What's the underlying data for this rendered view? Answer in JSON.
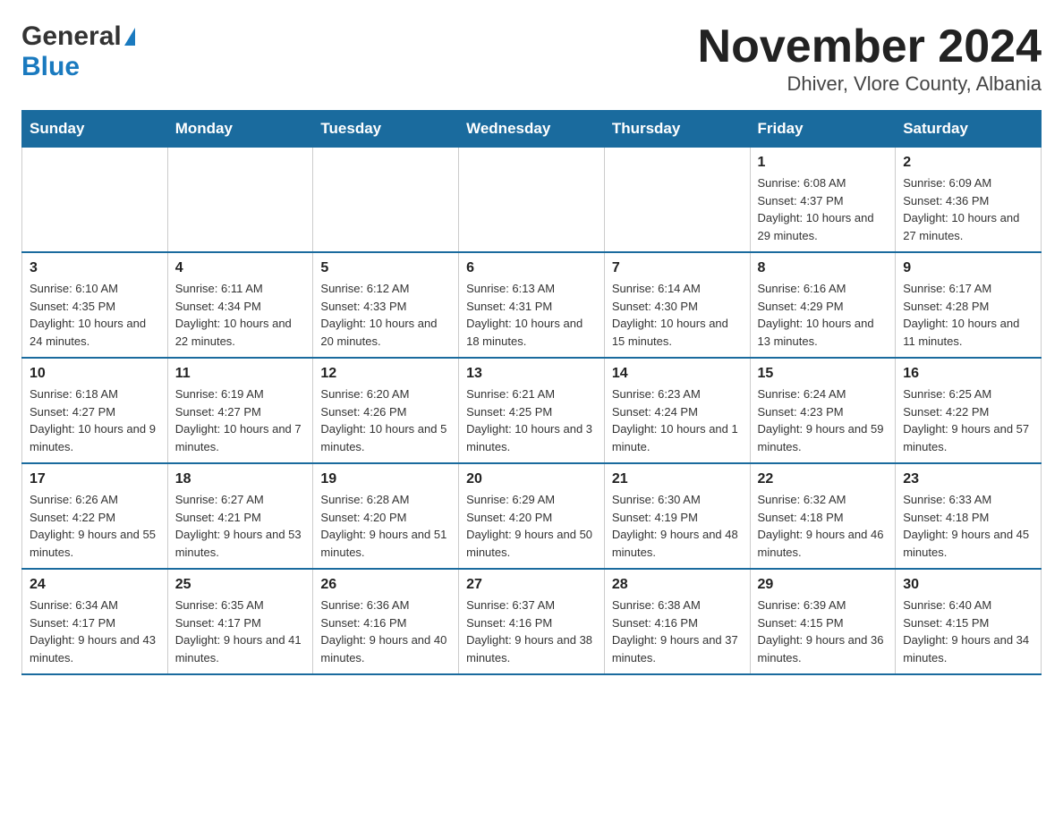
{
  "header": {
    "title": "November 2024",
    "subtitle": "Dhiver, Vlore County, Albania",
    "logo_general": "General",
    "logo_blue": "Blue"
  },
  "weekdays": [
    "Sunday",
    "Monday",
    "Tuesday",
    "Wednesday",
    "Thursday",
    "Friday",
    "Saturday"
  ],
  "weeks": [
    {
      "days": [
        {
          "number": "",
          "info": ""
        },
        {
          "number": "",
          "info": ""
        },
        {
          "number": "",
          "info": ""
        },
        {
          "number": "",
          "info": ""
        },
        {
          "number": "",
          "info": ""
        },
        {
          "number": "1",
          "info": "Sunrise: 6:08 AM\nSunset: 4:37 PM\nDaylight: 10 hours and 29 minutes."
        },
        {
          "number": "2",
          "info": "Sunrise: 6:09 AM\nSunset: 4:36 PM\nDaylight: 10 hours and 27 minutes."
        }
      ]
    },
    {
      "days": [
        {
          "number": "3",
          "info": "Sunrise: 6:10 AM\nSunset: 4:35 PM\nDaylight: 10 hours and 24 minutes."
        },
        {
          "number": "4",
          "info": "Sunrise: 6:11 AM\nSunset: 4:34 PM\nDaylight: 10 hours and 22 minutes."
        },
        {
          "number": "5",
          "info": "Sunrise: 6:12 AM\nSunset: 4:33 PM\nDaylight: 10 hours and 20 minutes."
        },
        {
          "number": "6",
          "info": "Sunrise: 6:13 AM\nSunset: 4:31 PM\nDaylight: 10 hours and 18 minutes."
        },
        {
          "number": "7",
          "info": "Sunrise: 6:14 AM\nSunset: 4:30 PM\nDaylight: 10 hours and 15 minutes."
        },
        {
          "number": "8",
          "info": "Sunrise: 6:16 AM\nSunset: 4:29 PM\nDaylight: 10 hours and 13 minutes."
        },
        {
          "number": "9",
          "info": "Sunrise: 6:17 AM\nSunset: 4:28 PM\nDaylight: 10 hours and 11 minutes."
        }
      ]
    },
    {
      "days": [
        {
          "number": "10",
          "info": "Sunrise: 6:18 AM\nSunset: 4:27 PM\nDaylight: 10 hours and 9 minutes."
        },
        {
          "number": "11",
          "info": "Sunrise: 6:19 AM\nSunset: 4:27 PM\nDaylight: 10 hours and 7 minutes."
        },
        {
          "number": "12",
          "info": "Sunrise: 6:20 AM\nSunset: 4:26 PM\nDaylight: 10 hours and 5 minutes."
        },
        {
          "number": "13",
          "info": "Sunrise: 6:21 AM\nSunset: 4:25 PM\nDaylight: 10 hours and 3 minutes."
        },
        {
          "number": "14",
          "info": "Sunrise: 6:23 AM\nSunset: 4:24 PM\nDaylight: 10 hours and 1 minute."
        },
        {
          "number": "15",
          "info": "Sunrise: 6:24 AM\nSunset: 4:23 PM\nDaylight: 9 hours and 59 minutes."
        },
        {
          "number": "16",
          "info": "Sunrise: 6:25 AM\nSunset: 4:22 PM\nDaylight: 9 hours and 57 minutes."
        }
      ]
    },
    {
      "days": [
        {
          "number": "17",
          "info": "Sunrise: 6:26 AM\nSunset: 4:22 PM\nDaylight: 9 hours and 55 minutes."
        },
        {
          "number": "18",
          "info": "Sunrise: 6:27 AM\nSunset: 4:21 PM\nDaylight: 9 hours and 53 minutes."
        },
        {
          "number": "19",
          "info": "Sunrise: 6:28 AM\nSunset: 4:20 PM\nDaylight: 9 hours and 51 minutes."
        },
        {
          "number": "20",
          "info": "Sunrise: 6:29 AM\nSunset: 4:20 PM\nDaylight: 9 hours and 50 minutes."
        },
        {
          "number": "21",
          "info": "Sunrise: 6:30 AM\nSunset: 4:19 PM\nDaylight: 9 hours and 48 minutes."
        },
        {
          "number": "22",
          "info": "Sunrise: 6:32 AM\nSunset: 4:18 PM\nDaylight: 9 hours and 46 minutes."
        },
        {
          "number": "23",
          "info": "Sunrise: 6:33 AM\nSunset: 4:18 PM\nDaylight: 9 hours and 45 minutes."
        }
      ]
    },
    {
      "days": [
        {
          "number": "24",
          "info": "Sunrise: 6:34 AM\nSunset: 4:17 PM\nDaylight: 9 hours and 43 minutes."
        },
        {
          "number": "25",
          "info": "Sunrise: 6:35 AM\nSunset: 4:17 PM\nDaylight: 9 hours and 41 minutes."
        },
        {
          "number": "26",
          "info": "Sunrise: 6:36 AM\nSunset: 4:16 PM\nDaylight: 9 hours and 40 minutes."
        },
        {
          "number": "27",
          "info": "Sunrise: 6:37 AM\nSunset: 4:16 PM\nDaylight: 9 hours and 38 minutes."
        },
        {
          "number": "28",
          "info": "Sunrise: 6:38 AM\nSunset: 4:16 PM\nDaylight: 9 hours and 37 minutes."
        },
        {
          "number": "29",
          "info": "Sunrise: 6:39 AM\nSunset: 4:15 PM\nDaylight: 9 hours and 36 minutes."
        },
        {
          "number": "30",
          "info": "Sunrise: 6:40 AM\nSunset: 4:15 PM\nDaylight: 9 hours and 34 minutes."
        }
      ]
    }
  ]
}
